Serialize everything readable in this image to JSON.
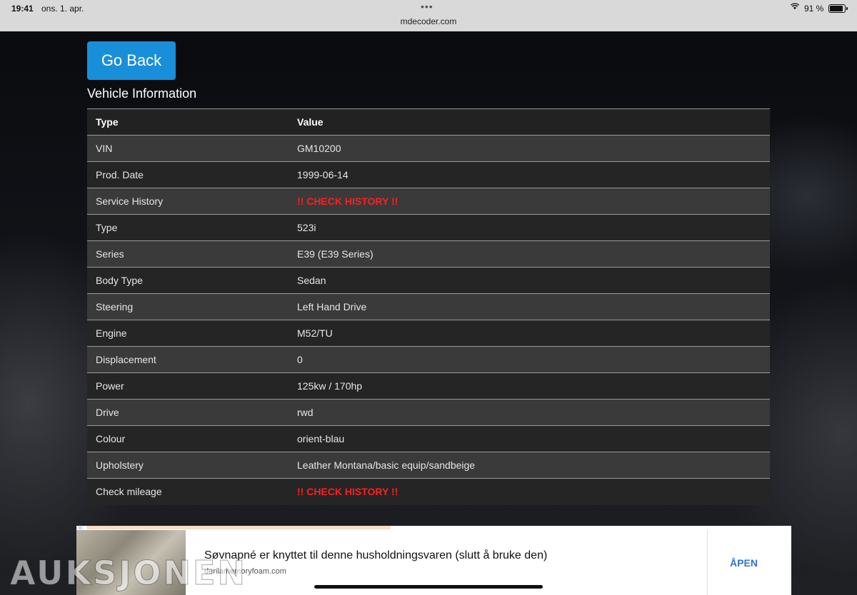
{
  "status_bar": {
    "time": "19:41",
    "date": "ons. 1. apr.",
    "url": "mdecoder.com",
    "battery_percent": "91 %",
    "battery_level": 0.91
  },
  "page": {
    "go_back_label": "Go Back",
    "section_title": "Vehicle Information"
  },
  "table": {
    "headers": [
      "Type",
      "Value"
    ],
    "rows": [
      {
        "type": "VIN",
        "value": "GM10200"
      },
      {
        "type": "Prod. Date",
        "value": "1999-06-14"
      },
      {
        "type": "Service History",
        "value": "!! CHECK HISTORY !!"
      },
      {
        "type": "Type",
        "value": "523i"
      },
      {
        "type": "Series",
        "value": "E39 (E39 Series)"
      },
      {
        "type": "Body Type",
        "value": "Sedan"
      },
      {
        "type": "Steering",
        "value": "Left Hand Drive"
      },
      {
        "type": "Engine",
        "value": "M52/TU"
      },
      {
        "type": "Displacement",
        "value": "0"
      },
      {
        "type": "Power",
        "value": "125kw / 170hp"
      },
      {
        "type": "Drive",
        "value": "rwd"
      },
      {
        "type": "Colour",
        "value": "orient-blau"
      },
      {
        "type": "Upholstery",
        "value": "Leather Montana/basic equip/sandbeige"
      },
      {
        "type": "Check mileage",
        "value": "!! CHECK HISTORY !!"
      }
    ]
  },
  "ad": {
    "headline": "Søvnapné er knyttet til denne husholdningsvaren (slutt å bruke den)",
    "domain": "derilamemoryfoam.com",
    "cta": "ÅPEN"
  },
  "watermark": "AUKSJONEN",
  "colors": {
    "button_blue": "#1a8fd9",
    "alert_red": "#ff1e1e",
    "cta_blue": "#2f73d6"
  }
}
